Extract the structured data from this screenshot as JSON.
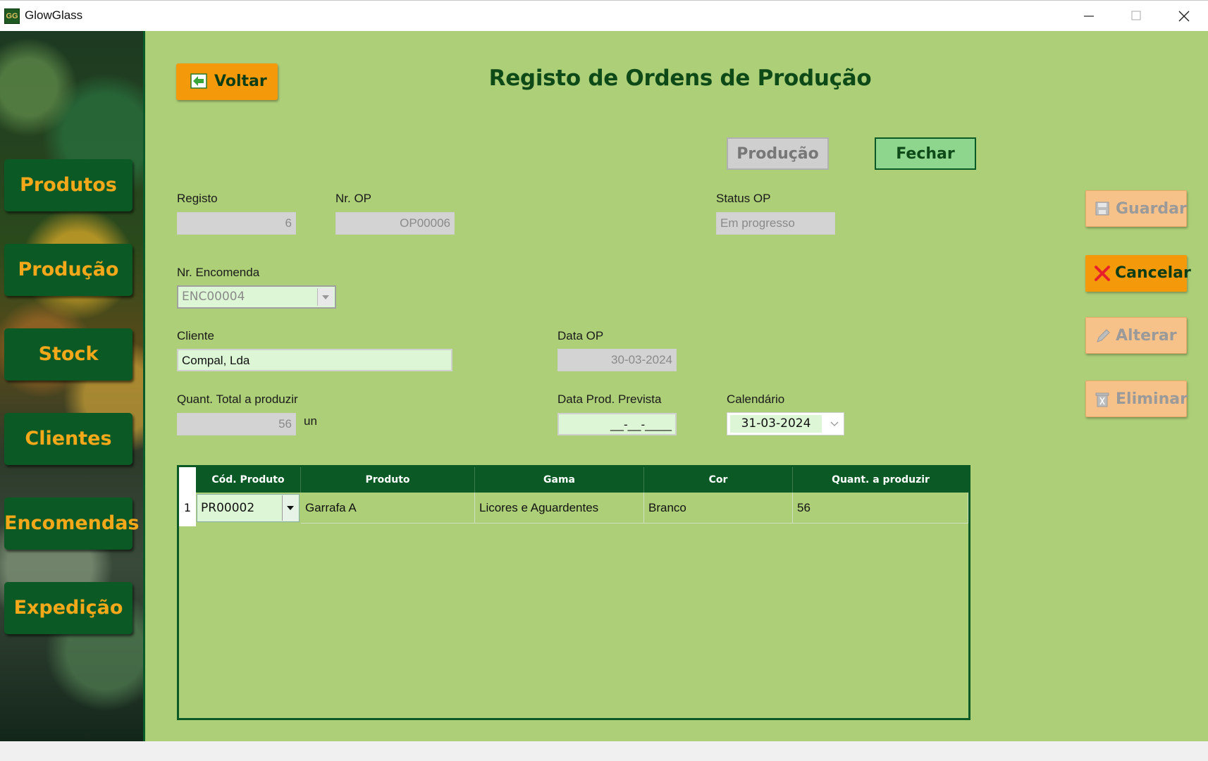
{
  "window": {
    "title": "GlowGlass",
    "logo_text": "GG"
  },
  "sidebar": {
    "items": [
      {
        "label": "Produtos"
      },
      {
        "label": "Produção"
      },
      {
        "label": "Stock"
      },
      {
        "label": "Clientes"
      },
      {
        "label": "Encomendas"
      },
      {
        "label": "Expedição"
      }
    ]
  },
  "header": {
    "back_label": "Voltar",
    "page_title": "Registo de Ordens de Produção"
  },
  "toolbar": {
    "producao_label": "Produção",
    "fechar_label": "Fechar"
  },
  "actions": {
    "guardar_label": "Guardar",
    "cancelar_label": "Cancelar",
    "alterar_label": "Alterar",
    "eliminar_label": "Eliminar"
  },
  "form": {
    "registo": {
      "label": "Registo",
      "value": "6"
    },
    "nr_op": {
      "label": "Nr. OP",
      "value": "OP00006"
    },
    "status_op": {
      "label": "Status OP",
      "value": "Em progresso"
    },
    "nr_encomenda": {
      "label": "Nr. Encomenda",
      "value": "ENC00004"
    },
    "cliente": {
      "label": "Cliente",
      "value": "Compal, Lda"
    },
    "data_op": {
      "label": "Data OP",
      "value": "30-03-2024"
    },
    "quant_total": {
      "label": "Quant. Total a produzir",
      "value": "56",
      "unit": "un"
    },
    "data_prevista": {
      "label": "Data Prod. Prevista",
      "value": "__-__-____"
    },
    "calendario": {
      "label": "Calendário",
      "value": "31-03-2024"
    }
  },
  "grid": {
    "columns": [
      "Cód. Produto",
      "Produto",
      "Gama",
      "Cor",
      "Quant. a produzir"
    ],
    "rows": [
      {
        "num": "1",
        "cod": "PR00002",
        "produto": "Garrafa A",
        "gama": "Licores e Aguardentes",
        "cor": "Branco",
        "quant": "56"
      }
    ]
  },
  "colors": {
    "background": "#adcf78",
    "accent_dark_green": "#0b5a26",
    "accent_orange": "#f49a0a",
    "nav_text": "#f3a81a"
  }
}
